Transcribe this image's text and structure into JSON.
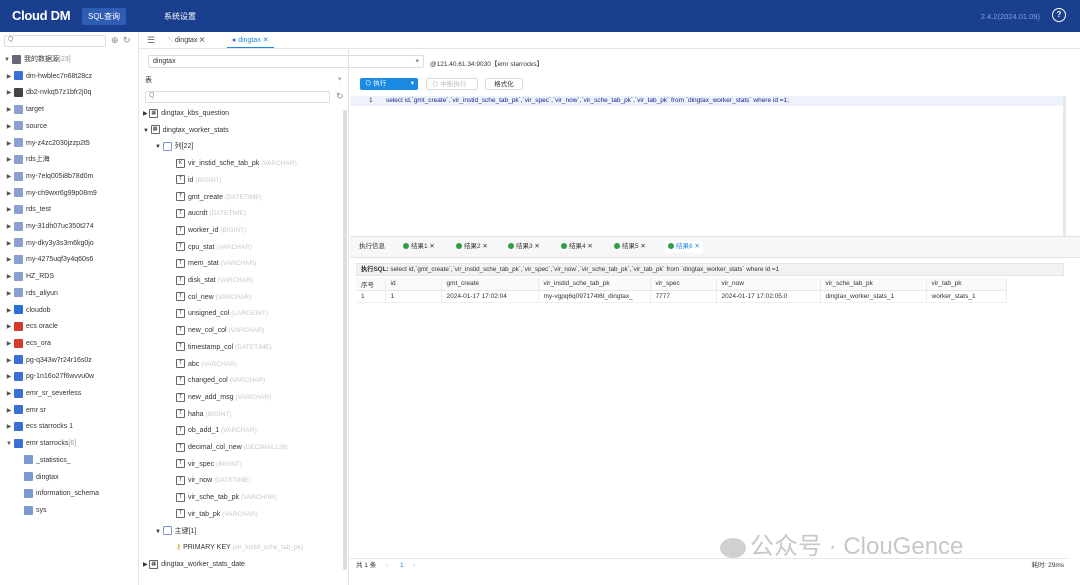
{
  "app": {
    "name": "Cloud DM",
    "version": "2.4.2(2024.01.09)"
  },
  "topnav": [
    {
      "label": "SQL查询",
      "active": true
    },
    {
      "label": "系统设置",
      "active": false
    }
  ],
  "left": {
    "search_placeholder": "Q",
    "root": {
      "label": "我的数据源",
      "count": "[23]"
    },
    "items": [
      {
        "label": "dm-hwblec7n68t28cz",
        "color": "#3a6fd8"
      },
      {
        "label": "db2-nvkq57z1bfr2j0q",
        "color": "#444444"
      },
      {
        "label": "target",
        "color": "#8aa0d0"
      },
      {
        "label": "source",
        "color": "#8aa0d0"
      },
      {
        "label": "my-z4zc2030jzzp2t5",
        "color": "#8aa0d0"
      },
      {
        "label": "rds上海",
        "color": "#8aa0d0"
      },
      {
        "label": "my-7elq005i8b78d0m",
        "color": "#8aa0d0"
      },
      {
        "label": "my-ch9wxr6g99p08m9",
        "color": "#8aa0d0"
      },
      {
        "label": "rds_test",
        "color": "#8aa0d0"
      },
      {
        "label": "my-31dh07uc350t274",
        "color": "#8aa0d0"
      },
      {
        "label": "my-dky3y3s3m6kg0jo",
        "color": "#8aa0d0"
      },
      {
        "label": "my-4275uqf3y4q60s6",
        "color": "#8aa0d0"
      },
      {
        "label": "HZ_RDS",
        "color": "#8aa0d0"
      },
      {
        "label": "rds_aliyun",
        "color": "#8aa0d0"
      },
      {
        "label": "cloudob",
        "color": "#2a6fd8"
      },
      {
        "label": "ecs oracle",
        "color": "#d73a2a"
      },
      {
        "label": "ecs_ora",
        "color": "#d73a2a"
      },
      {
        "label": "pg-q343w7r24r16s0z",
        "color": "#3a6fd8"
      },
      {
        "label": "pg-1n16o27f6wvvu0w",
        "color": "#3a6fd8"
      },
      {
        "label": "emr_sr_severless",
        "color": "#3a6fd8"
      },
      {
        "label": "emr sr",
        "color": "#3a6fd8"
      },
      {
        "label": "ecs starrocks 1",
        "color": "#3a6fd8"
      }
    ],
    "expanded": {
      "label": "emr starrocks",
      "count": "[6]"
    },
    "schemas": [
      "_statistics_",
      "dingtax",
      "information_schema",
      "sys"
    ]
  },
  "tabs": [
    {
      "label": "dingtax",
      "active": false
    },
    {
      "label": "dingtax",
      "active": true
    }
  ],
  "mid": {
    "db": "dingtax",
    "conn": "@121.40.61.34:9030【emr starrocks】",
    "type_label": "表",
    "search_placeholder": "Q",
    "tables": [
      "dingtax_kbs_question",
      "dingtax_worker_stats"
    ],
    "col_group": "列[22]",
    "columns": [
      {
        "name": "vir_instid_sche_tab_pk",
        "type": "(VARCHAR)"
      },
      {
        "name": "id",
        "type": "(BIGINT)"
      },
      {
        "name": "gmt_create",
        "type": "(DATETIME)"
      },
      {
        "name": "aucrdt",
        "type": "(DATETIME)"
      },
      {
        "name": "worker_id",
        "type": "(BIGINT)"
      },
      {
        "name": "cpu_stat",
        "type": "(VARCHAR)"
      },
      {
        "name": "mem_stat",
        "type": "(VARCHAR)"
      },
      {
        "name": "disk_stat",
        "type": "(VARCHAR)"
      },
      {
        "name": "col_new",
        "type": "(VARCHAR)"
      },
      {
        "name": "unsigned_col",
        "type": "(LARGEINT)"
      },
      {
        "name": "new_col_col",
        "type": "(VARCHAR)"
      },
      {
        "name": "timestamp_col",
        "type": "(DATETIME)"
      },
      {
        "name": "abc",
        "type": "(VARCHAR)"
      },
      {
        "name": "changed_col",
        "type": "(VARCHAR)"
      },
      {
        "name": "new_add_msg",
        "type": "(VARCHAR)"
      },
      {
        "name": "haha",
        "type": "(BIGINT)"
      },
      {
        "name": "ob_add_1",
        "type": "(VARCHAR)"
      },
      {
        "name": "decimal_col_new",
        "type": "(DECIMAL128)"
      },
      {
        "name": "vir_spec",
        "type": "(BIGINT)"
      },
      {
        "name": "vir_now",
        "type": "(DATETIME)"
      },
      {
        "name": "vir_sche_tab_pk",
        "type": "(VARCHAR)"
      },
      {
        "name": "vir_tab_pk",
        "type": "(VARCHAR)"
      }
    ],
    "pk_group": "主键[1]",
    "pk": {
      "name": "PRIMARY KEY",
      "cols": "(vir_instid_sche_tab_pk)"
    },
    "last_table": "dingtax_worker_stats_date"
  },
  "editor": {
    "run_label": "执行",
    "stop_label": "中断执行",
    "format_label": "格式化",
    "line_no": "1",
    "sql": "select id,`gmt_create`,`vir_instid_sche_tab_pk`,`vir_spec`,`vir_now`,`vir_sche_tab_pk`,`vir_tab_pk` from `dingtax_worker_stats` where id =1;"
  },
  "results": {
    "tabs": [
      {
        "label": "执行信息",
        "dot": false,
        "active": false
      },
      {
        "label": "结果1",
        "dot": true,
        "active": false
      },
      {
        "label": "结果2",
        "dot": true,
        "active": false
      },
      {
        "label": "结果3",
        "dot": true,
        "active": false
      },
      {
        "label": "结果4",
        "dot": true,
        "active": false
      },
      {
        "label": "结果5",
        "dot": true,
        "active": false
      },
      {
        "label": "结果6",
        "dot": true,
        "active": true
      }
    ],
    "sql_label": "执行SQL:",
    "sql": "select id,`gmt_create`,`vir_instid_sche_tab_pk`,`vir_spec`,`vir_now`,`vir_sche_tab_pk`,`vir_tab_pk` from `dingtax_worker_stats` where id =1",
    "headers": [
      "序号",
      "id",
      "gmt_create",
      "vir_instid_sche_tab_pk",
      "vir_spec",
      "vir_now",
      "vir_sche_tab_pk",
      "vir_tab_pk"
    ],
    "rows": [
      [
        "1",
        "1",
        "2024-01-17 17:02:04",
        "my-vgpq6q097174t6t_dingtax_",
        "7777",
        "2024-01-17 17:02:05.0",
        "dingtax_worker_stats_1",
        "worker_stats_1"
      ]
    ],
    "total": "共 1 条",
    "page": "1",
    "elapsed": "耗时: 29ms"
  },
  "watermark": "公众号 · ClouGence"
}
